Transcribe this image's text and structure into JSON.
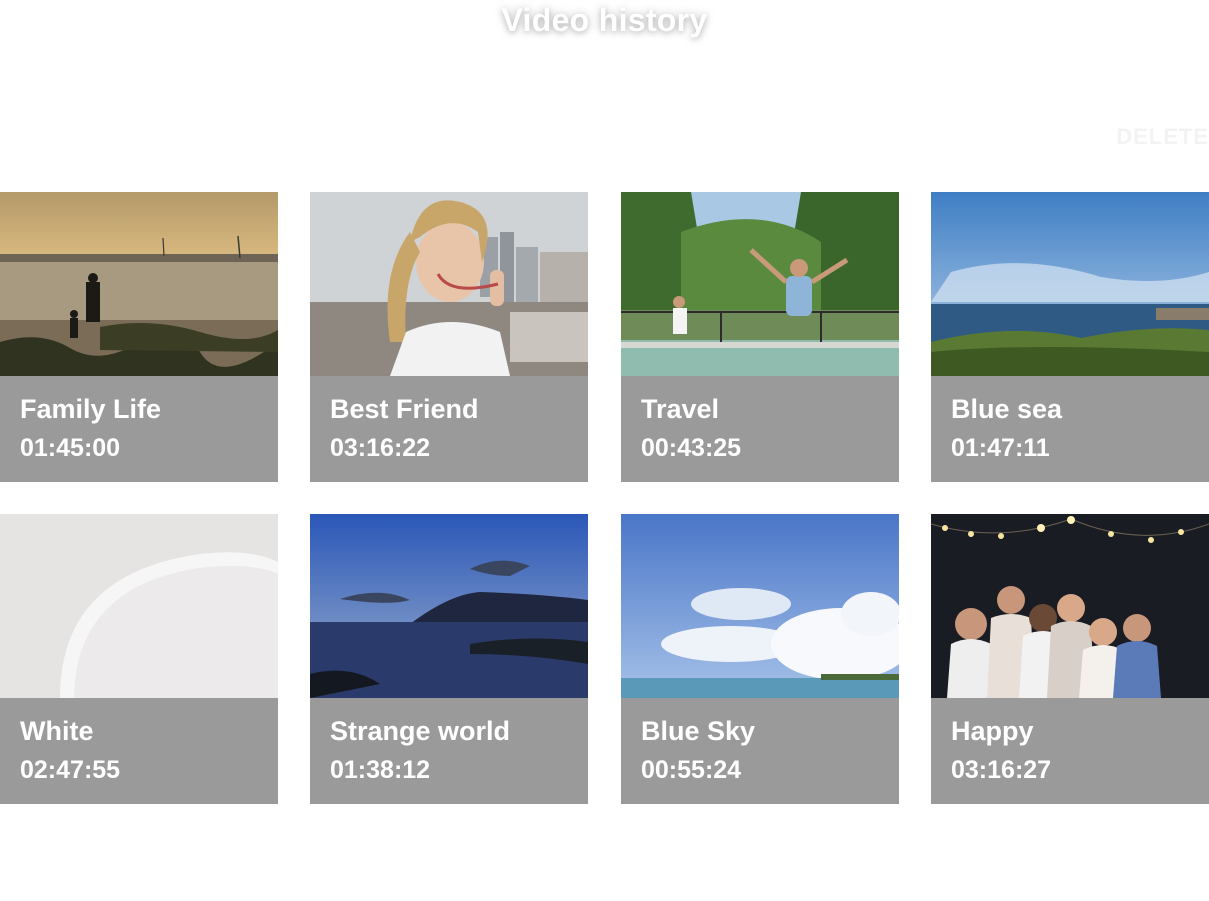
{
  "header": {
    "title": "Video history",
    "subtitle": "",
    "delete_label": "DELETE"
  },
  "videos": [
    {
      "title": "Family Life",
      "duration": "01:45:00",
      "thumbnail": "sunset-beach-family-photo"
    },
    {
      "title": "Best Friend",
      "duration": "03:16:22",
      "thumbnail": "selfie-city-photo"
    },
    {
      "title": "Travel",
      "duration": "00:43:25",
      "thumbnail": "pool-jump-forest-photo"
    },
    {
      "title": "Blue sea",
      "duration": "01:47:11",
      "thumbnail": "coast-blue-sky-photo"
    },
    {
      "title": "White",
      "duration": "02:47:55",
      "thumbnail": "white-plate-photo"
    },
    {
      "title": "Strange world",
      "duration": "01:38:12",
      "thumbnail": "dusk-island-sea-photo"
    },
    {
      "title": "Blue Sky",
      "duration": "00:55:24",
      "thumbnail": "clouds-sea-photo"
    },
    {
      "title": "Happy",
      "duration": "03:16:27",
      "thumbnail": "friends-party-lights-photo"
    }
  ],
  "colors": {
    "card_background": "#9a9a9a",
    "card_text": "#ffffff",
    "page_background": "#ffffff"
  }
}
